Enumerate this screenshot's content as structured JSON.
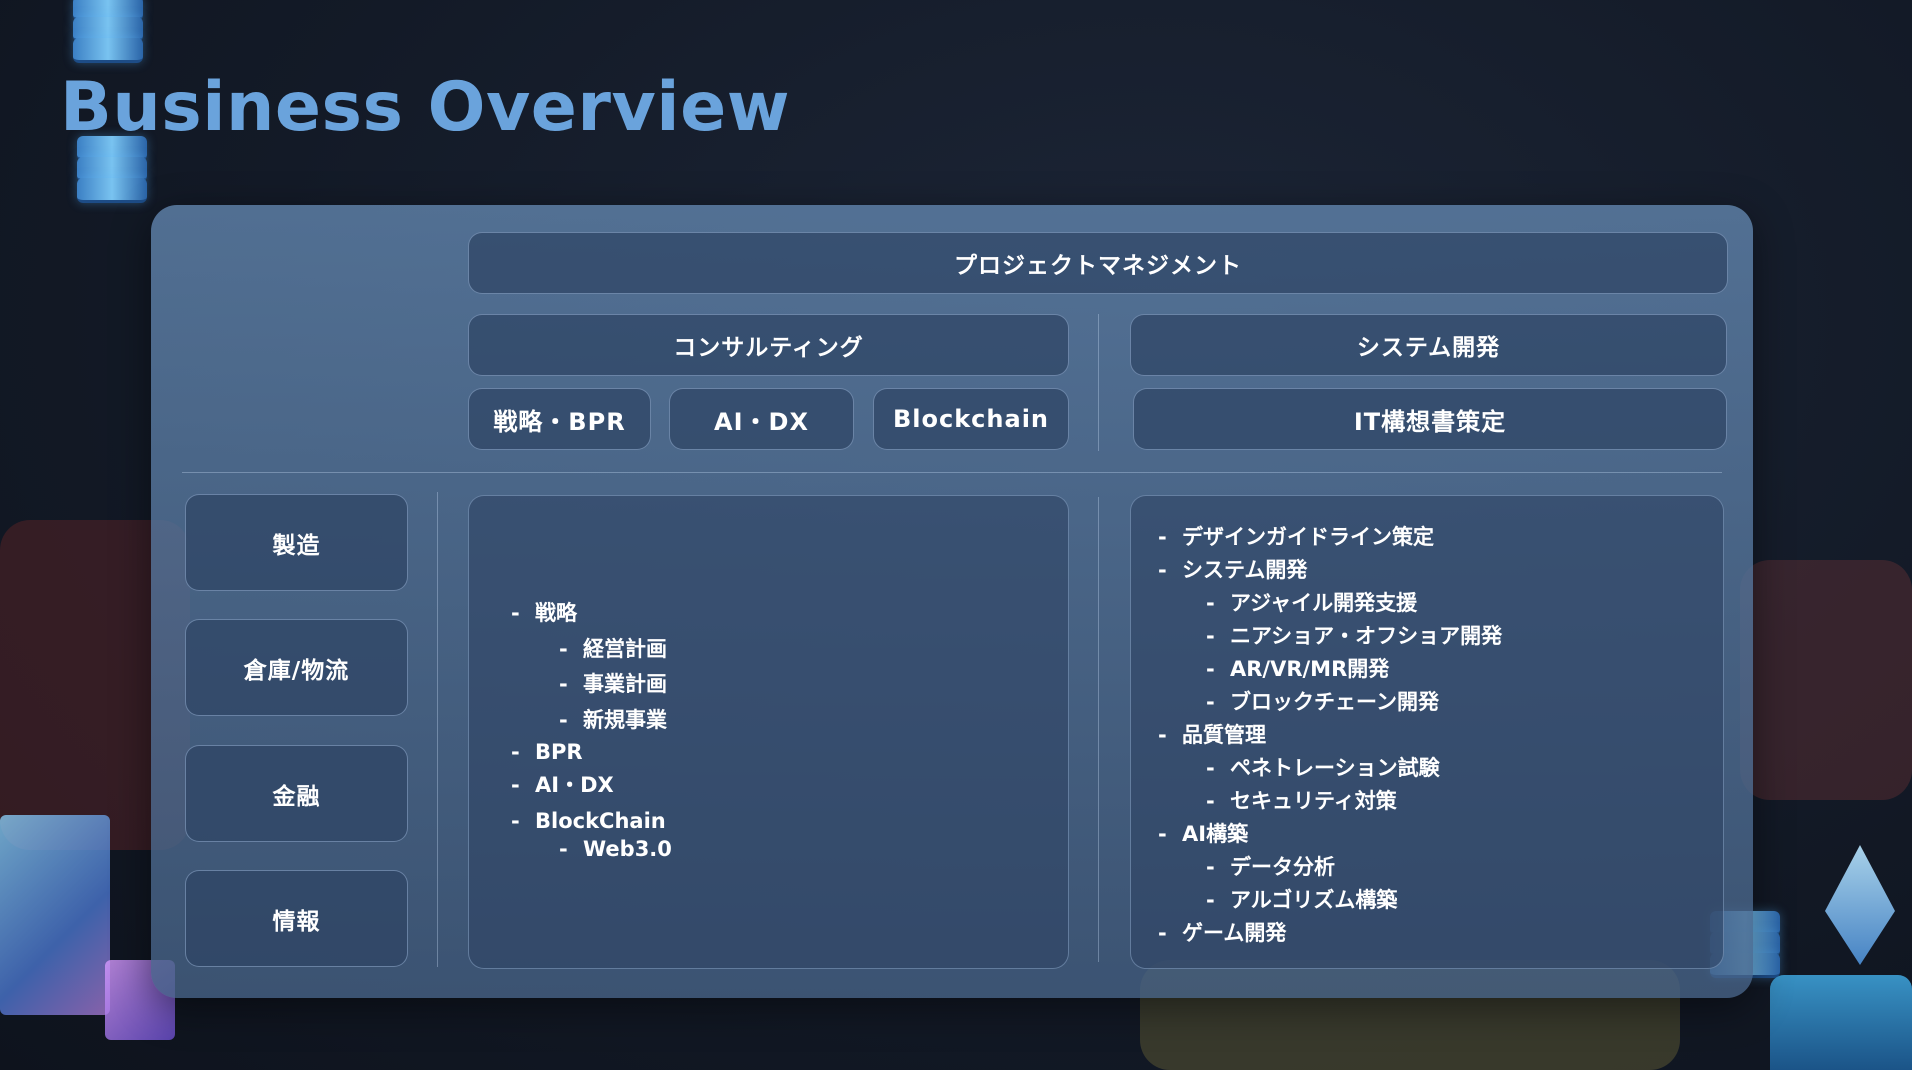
{
  "page": {
    "title": "Business Overview"
  },
  "header_row": {
    "pm_label": "プロジェクトマネジメント"
  },
  "columns": {
    "consulting": {
      "label": "コンサルティング",
      "subs": [
        "戦略・BPR",
        "AI・DX",
        "Blockchain"
      ]
    },
    "system": {
      "label": "システム開発",
      "sub": "IT構想書策定"
    }
  },
  "industries": [
    "製造",
    "倉庫/物流",
    "金融",
    "情報"
  ],
  "consulting_items": [
    {
      "dash": "-",
      "text": "戦略"
    },
    {
      "dash": "-",
      "text": "経営計画"
    },
    {
      "dash": "-",
      "text": "事業計画"
    },
    {
      "dash": "-",
      "text": "新規事業"
    },
    {
      "dash": "-",
      "text": "BPR"
    },
    {
      "dash": "-",
      "text": "AI・DX"
    },
    {
      "dash": "-",
      "text": "BlockChain"
    },
    {
      "dash": "-",
      "text": "Web3.0"
    }
  ],
  "system_items": [
    {
      "dash": "-",
      "text": "デザインガイドライン策定"
    },
    {
      "dash": "-",
      "text": "システム開発"
    },
    {
      "dash": "-",
      "text": "アジャイル開発支援"
    },
    {
      "dash": "-",
      "text": "ニアショア・オフショア開発"
    },
    {
      "dash": "-",
      "text": "AR/VR/MR開発"
    },
    {
      "dash": "-",
      "text": "ブロックチェーン開発"
    },
    {
      "dash": "-",
      "text": "品質管理"
    },
    {
      "dash": "-",
      "text": "ペネトレーション試験"
    },
    {
      "dash": "-",
      "text": "セキュリティ対策"
    },
    {
      "dash": "-",
      "text": "AI構築"
    },
    {
      "dash": "-",
      "text": "データ分析"
    },
    {
      "dash": "-",
      "text": "アルゴリズム構築"
    },
    {
      "dash": "-",
      "text": "ゲーム開発"
    }
  ],
  "colors": {
    "title": "#6aa3dc",
    "panel": "#5f82aa",
    "box": "#2e4464"
  }
}
